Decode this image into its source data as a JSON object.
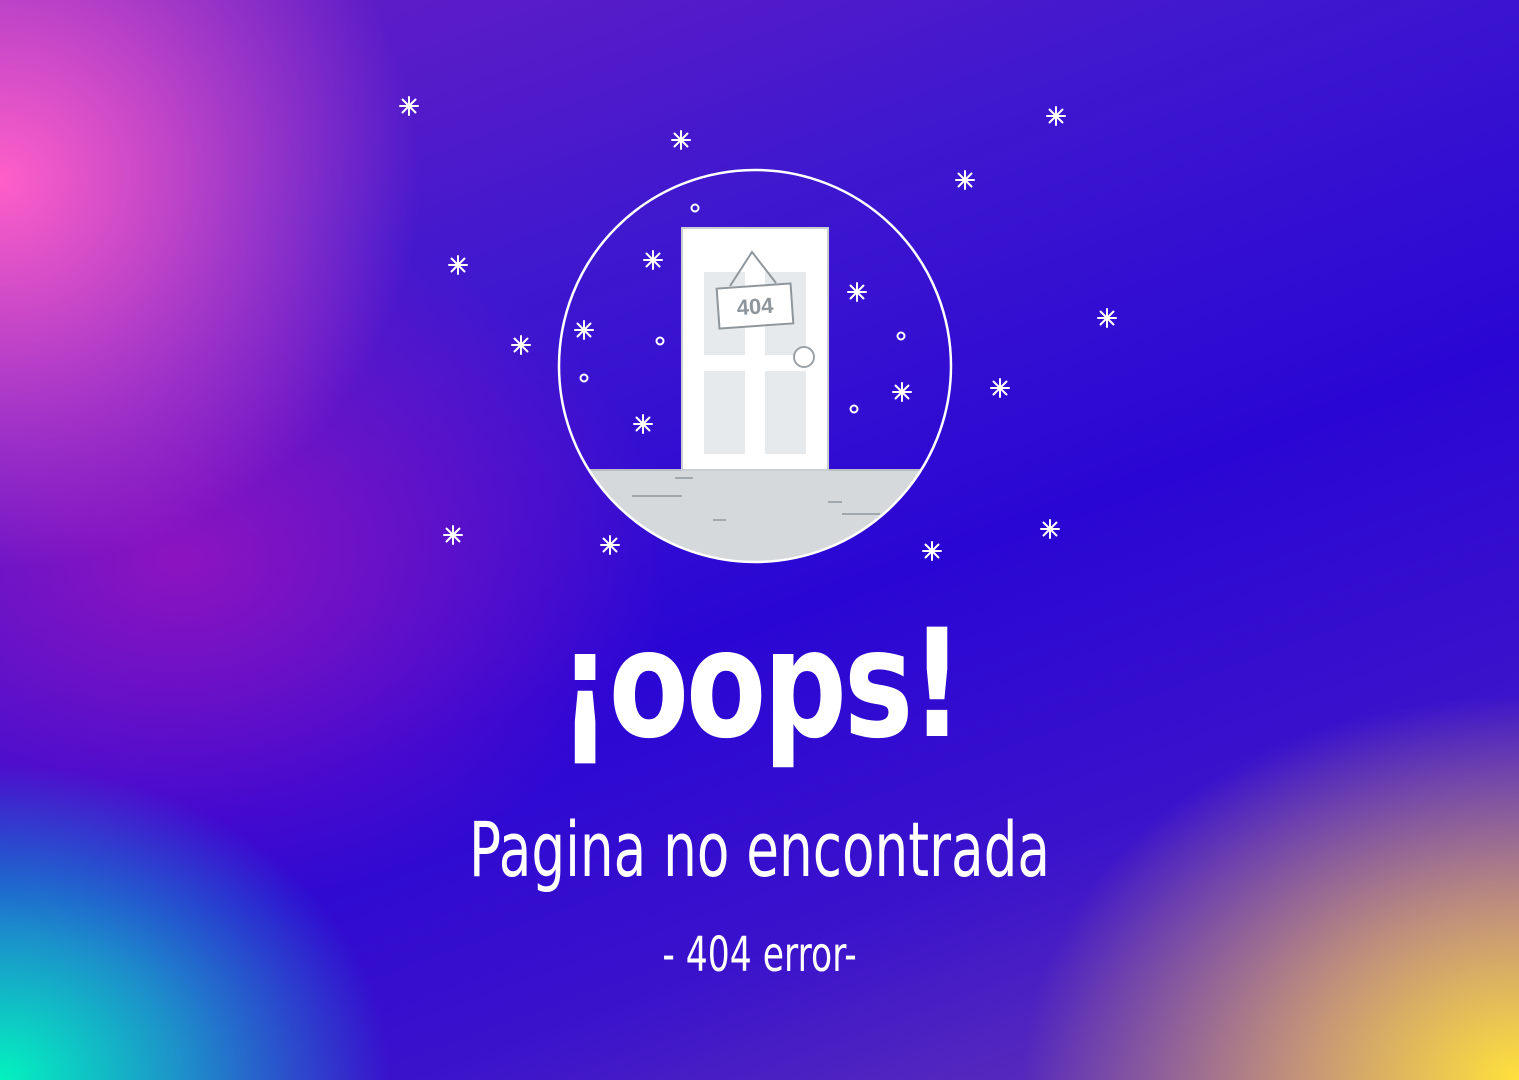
{
  "page": {
    "heading": "¡oops!",
    "subheading": "Pagina no encontrada",
    "error_code": "- 404 error-"
  },
  "illustration": {
    "sign_text": "404",
    "icons": [
      "sparkle-icon",
      "door-icon",
      "door-sign-icon"
    ]
  },
  "colors": {
    "text": "#ffffff",
    "background_main": "#2a06d4",
    "background_pink": "#ff5fc8",
    "background_teal": "#00ffbe",
    "background_yellow": "#ffe13c",
    "door": "#ffffff",
    "floor": "#d5d9dc"
  }
}
